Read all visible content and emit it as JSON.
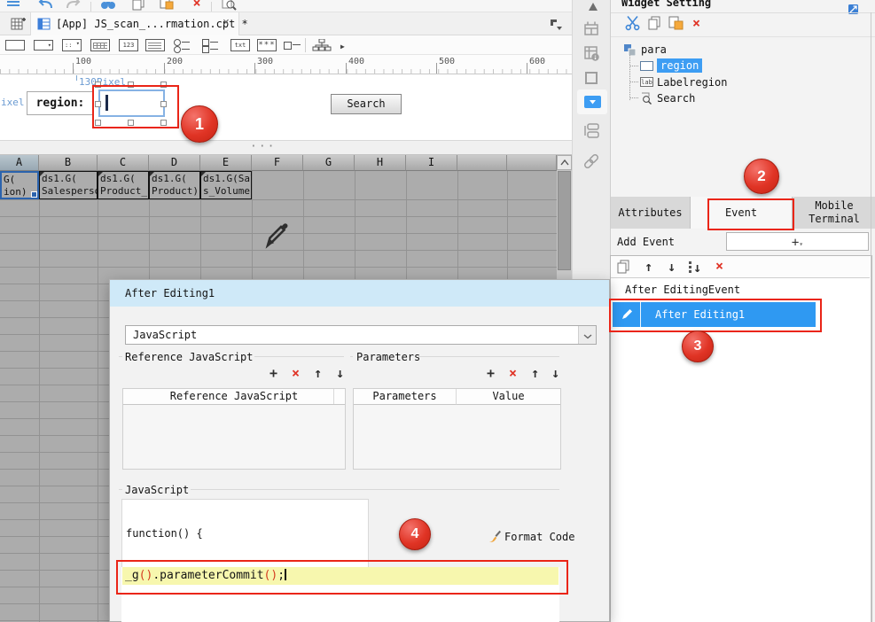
{
  "glyphs": {
    "plus": "+",
    "close": "×",
    "up": "↑",
    "down": "↓",
    "caret": "▾",
    "dots": "···",
    "num": "123",
    "label_txt": "txt",
    "password": "***",
    "lab": "lab",
    "arrow": "▶"
  },
  "colors": {
    "annotation_red": "#ea2517",
    "selection_blue": "#3d9df3",
    "highlight_yellow": "#f7f7ae",
    "code_paren": "#d43c20",
    "title_blue": "#cfe9f8"
  },
  "tab_bar": {
    "tab_title": "[App] JS_scan_...rmation.cpt *"
  },
  "ruler": {
    "unit_labels": [
      "100",
      "200",
      "300",
      "400",
      "500",
      "600"
    ]
  },
  "canvas": {
    "width_hint": "130Pixel",
    "left_hint": "ixel",
    "region_label": "region:",
    "search_button": "Search"
  },
  "grid": {
    "column_headers": [
      "A",
      "B",
      "C",
      "D",
      "E",
      "F",
      "G",
      "H",
      "I"
    ],
    "cells": [
      {
        "line1": "G(",
        "line2": "ion)"
      },
      {
        "line1": "ds1.G(",
        "line2": "Salesperson"
      },
      {
        "line1": "ds1.G(",
        "line2": "Product_"
      },
      {
        "line1": "ds1.G(",
        "line2": "Product)"
      },
      {
        "line1": "ds1.G(Sale",
        "line2": "s_Volume)"
      }
    ]
  },
  "dialog": {
    "title": "After Editing1",
    "language_value": "JavaScript",
    "reference_group": {
      "label": "Reference JavaScript",
      "table_header": "Reference JavaScript"
    },
    "parameters_group": {
      "label": "Parameters",
      "col1": "Parameters",
      "col2": "Value"
    },
    "js_group": {
      "label": "JavaScript",
      "function_line": "function() {",
      "format_code_label": "Format Code",
      "code_tokens": [
        [
          "_g",
          "id"
        ],
        [
          "()",
          "pn"
        ],
        [
          ".parameterCommit",
          "id"
        ],
        [
          "()",
          "pn"
        ],
        [
          ";",
          "id"
        ]
      ]
    }
  },
  "widget_panel": {
    "title": "Widget Setting",
    "tree": {
      "root": "para",
      "items": [
        "region",
        "Labelregion",
        "Search"
      ],
      "selected": "region"
    },
    "tabs": [
      "Attributes",
      "Event",
      "Mobile Terminal"
    ],
    "active_tab": "Event",
    "add_event_label": "Add Event",
    "event_list": {
      "header": "After EditingEvent",
      "selected_item": "After Editing1"
    }
  },
  "annotations": {
    "badges": [
      "1",
      "2",
      "3",
      "4"
    ]
  }
}
